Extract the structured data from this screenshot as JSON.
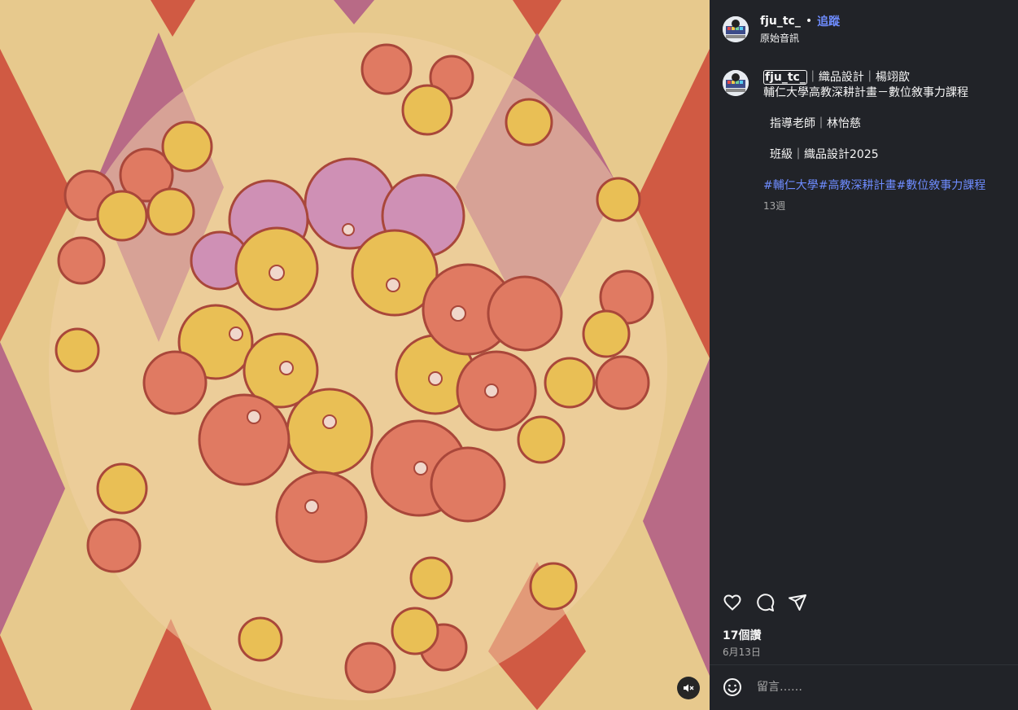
{
  "post": {
    "username": "fju_tc_",
    "separator": "•",
    "follow_label": "追蹤",
    "audio_label": "原始音訊"
  },
  "caption": {
    "username": "fju_tc_",
    "title_suffix": "｜織品設計｜楊翊歆",
    "line2": "輔仁大學高教深耕計畫－數位敘事力課程",
    "teacher": "指導老師｜林怡慈",
    "class": "班級｜織品設計2025",
    "hashtags": "#輔仁大學#高教深耕計畫#數位敘事力課程",
    "age": "13週"
  },
  "stats": {
    "likes": "17個讚",
    "date": "6月13日"
  },
  "comment": {
    "placeholder": "留言……"
  },
  "icons": {
    "like": "heart-icon",
    "comment": "comment-icon",
    "share": "send-icon",
    "emoji": "emoji-icon",
    "mute": "speaker-muted-icon"
  },
  "colors": {
    "background": "#212328",
    "link": "#6e8cff",
    "diamond_red": "#d05a43",
    "diamond_purple": "#b86a86",
    "diamond_cream": "#e7c98d",
    "flower_coral": "#e07a62",
    "flower_yellow": "#e9bf55",
    "flower_pink": "#cf90b5"
  }
}
